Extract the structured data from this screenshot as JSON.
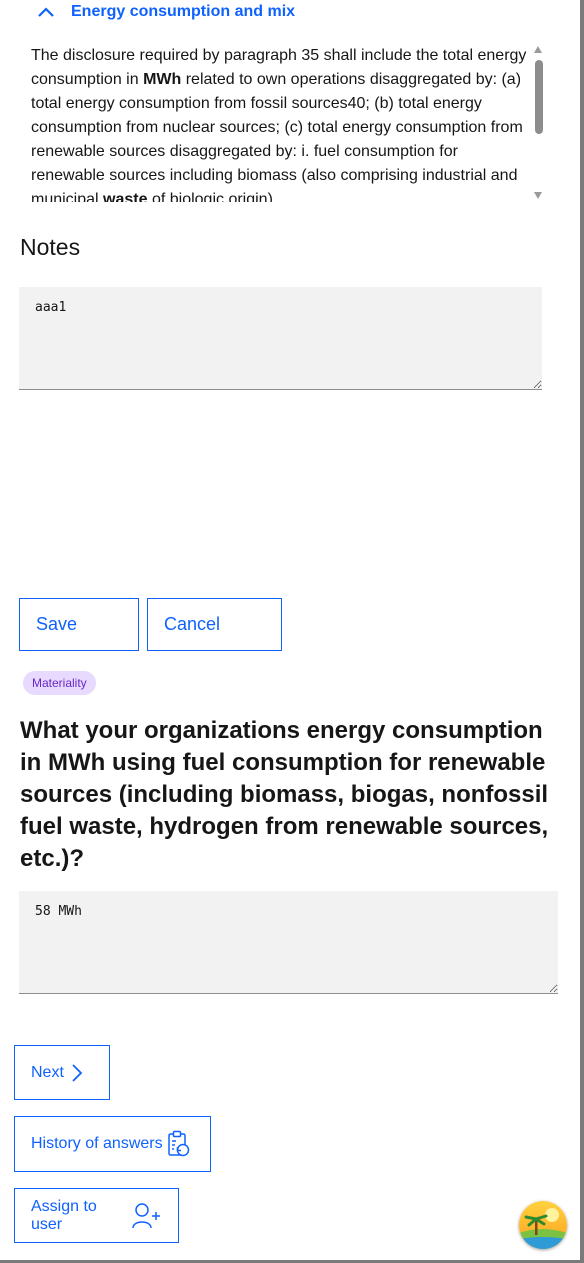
{
  "accordion": {
    "title": "Energy consumption and mix"
  },
  "disclosure": {
    "line1": "The disclosure required by paragraph 35 shall include the total energy consumption in ",
    "mwh": "MWh",
    "line2": " related to own operations disaggregated by: (a) total energy consumption from fossil sources40; (b) total energy consumption from nuclear sources; (c) total energy consumption from renewable sources disaggregated by: i. fuel consumption for renewable sources including biomass (also comprising industrial and municipal ",
    "waste": "waste",
    "line3": " of biologic origin)"
  },
  "notes": {
    "label": "Notes",
    "value": "aaa1"
  },
  "actions": {
    "save_label": "Save",
    "cancel_label": "Cancel"
  },
  "tag": {
    "label": "Materiality"
  },
  "question": {
    "text": "What your organizations energy consumption in MWh using fuel consumption for renewable sources (including biomass, biogas, nonfossil fuel waste, hydrogen from renewable sources, etc.)?",
    "answer": "58 MWh"
  },
  "navigation": {
    "next_label": "Next",
    "history_label": "History of answers",
    "assign_label": "Assign to user"
  },
  "icons": {
    "chevron_up": "chevron-up-icon",
    "chevron_right": "chevron-right-icon",
    "history": "clipboard-history-icon",
    "assign": "user-add-icon"
  },
  "colors": {
    "primary": "#0f62fe",
    "tag_bg": "#e8daff",
    "tag_text": "#6929c4",
    "field_bg": "#f2f2f2"
  }
}
